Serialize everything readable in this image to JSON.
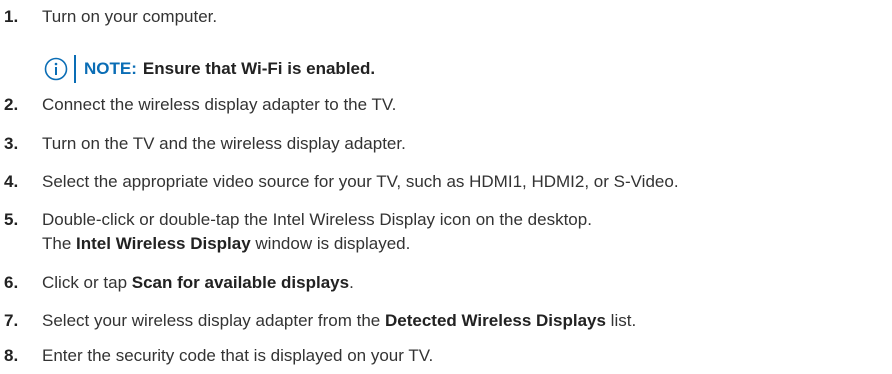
{
  "steps": [
    {
      "num": "1.",
      "text": "Turn on your computer."
    },
    {
      "num": "2.",
      "text": "Connect the wireless display adapter to the TV."
    },
    {
      "num": "3.",
      "text": "Turn on the TV and the wireless display adapter."
    },
    {
      "num": "4.",
      "text": "Select the appropriate video source for your TV, such as HDMI1, HDMI2, or S-Video."
    },
    {
      "num": "5.",
      "text": "Double-click or double-tap the Intel Wireless Display icon on the desktop.",
      "line2_pre": "The ",
      "line2_bold": "Intel Wireless Display",
      "line2_post": " window is displayed."
    },
    {
      "num": "6.",
      "pre": "Click or tap ",
      "bold": "Scan for available displays",
      "post": "."
    },
    {
      "num": "7.",
      "pre": "Select your wireless display adapter from the ",
      "bold": "Detected Wireless Displays",
      "post": " list."
    },
    {
      "num": "8.",
      "text": "Enter the security code that is displayed on your TV."
    }
  ],
  "note": {
    "label": "NOTE:",
    "text": "Ensure that Wi-Fi is enabled.",
    "icon": "info-icon",
    "accent_color": "#0a6db5"
  }
}
